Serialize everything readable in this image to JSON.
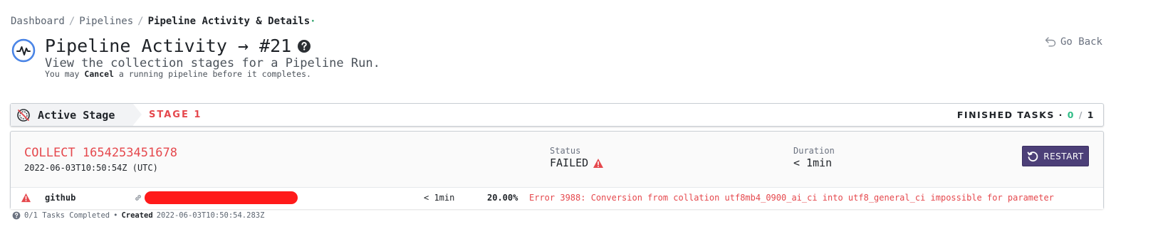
{
  "breadcrumb": {
    "items": [
      "Dashboard",
      "Pipelines"
    ],
    "separator": "/",
    "current": "Pipeline Activity & Details",
    "dot": "·"
  },
  "header": {
    "title": "Pipeline Activity → #21",
    "subtitle": "View the collection stages for a Pipeline Run.",
    "note_prefix": "You may",
    "note_emphasis": "Cancel",
    "note_suffix": "a running pipeline before it completes.",
    "go_back": "Go Back"
  },
  "stage_bar": {
    "active_label": "Active Stage",
    "stage_name": "STAGE 1",
    "finished_label": "FINISHED TASKS ·",
    "finished_done": "0",
    "finished_sep": "/",
    "finished_total": "1"
  },
  "task": {
    "title": "COLLECT 1654253451678",
    "date": "2022-06-03T10:50:54Z (UTC)",
    "status_label": "Status",
    "status_value": "FAILED",
    "duration_label": "Duration",
    "duration_value": "< 1min",
    "restart_label": "RESTART"
  },
  "task_row": {
    "provider": "github",
    "duration": "< 1min",
    "progress": "20.00%",
    "error": "Error 3988: Conversion from collation utf8mb4_0900_ai_ci into utf8_general_ci impossible for parameter"
  },
  "footer": {
    "tasks_completed": "0/1 Tasks Completed",
    "bullet": "•",
    "created_label": "Created",
    "created_value": "2022-06-03T10:50:54.283Z"
  },
  "colors": {
    "accent": "#4c3f78",
    "error": "#e5484d",
    "success": "#2ebc85"
  },
  "icons": [
    "pipeline-activity-icon",
    "help-icon",
    "undo-icon",
    "stage-icon",
    "warning-icon",
    "restart-icon",
    "link-icon"
  ]
}
